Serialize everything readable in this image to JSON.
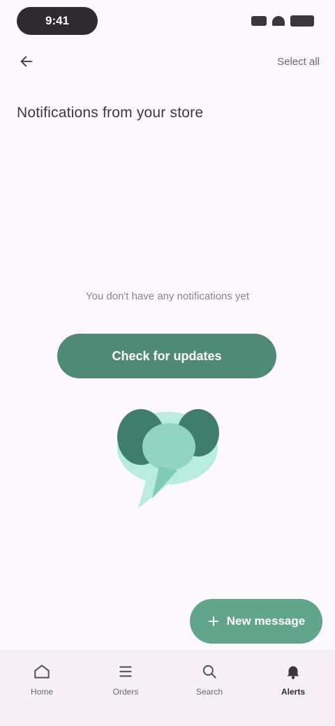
{
  "status_bar": {
    "time": "9:41"
  },
  "toolbar": {
    "back_icon": "arrow-left-icon",
    "action_label": "Select all"
  },
  "page": {
    "title": "Notifications from your store"
  },
  "empty_state": {
    "message": "You don't have any notifications yet",
    "button_label": "Check for updates",
    "illustration_icon": "chat-bubble-icon"
  },
  "fab": {
    "label": "New message",
    "icon": "plus-icon"
  },
  "bottom_nav": {
    "items": [
      {
        "label": "Home",
        "icon": "home-icon"
      },
      {
        "label": "Orders",
        "icon": "list-icon"
      },
      {
        "label": "Search",
        "icon": "search-icon"
      },
      {
        "label": "Alerts",
        "icon": "bell-icon"
      }
    ]
  },
  "colors": {
    "accent": "#4f8a76",
    "accent_light": "#62a58d",
    "background": "#fcf8fb"
  }
}
